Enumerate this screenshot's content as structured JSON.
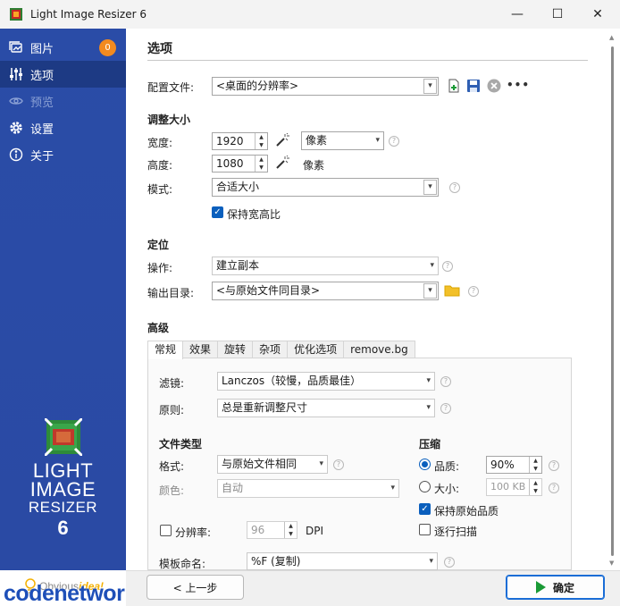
{
  "window": {
    "title": "Light Image Resizer 6",
    "controls": {
      "minimize": "—",
      "maximize": "☐",
      "close": "✕"
    }
  },
  "sidebar": {
    "items": [
      {
        "label": "图片",
        "icon": "images-icon",
        "badge": "0"
      },
      {
        "label": "选项",
        "icon": "sliders-icon",
        "active": true
      },
      {
        "label": "预览",
        "icon": "eye-icon",
        "disabled": true
      },
      {
        "label": "设置",
        "icon": "gear-icon"
      },
      {
        "label": "关于",
        "icon": "info-icon"
      }
    ],
    "logo": {
      "line1": "LIGHT",
      "line2": "IMAGE",
      "line3": "RESIZER",
      "version": "6"
    },
    "vendor": {
      "prefix": "Obvious",
      "emph": "idea!"
    },
    "watermark": "codenetwork.cn"
  },
  "page": {
    "title": "选项"
  },
  "profile": {
    "label": "配置文件:",
    "value": "<桌面的分辨率>",
    "more": "•••"
  },
  "resize": {
    "heading": "调整大小",
    "width_label": "宽度:",
    "width_value": "1920",
    "width_unit": "像素",
    "height_label": "高度:",
    "height_value": "1080",
    "height_unit": "像素",
    "mode_label": "模式:",
    "mode_value": "合适大小",
    "keep_ratio_label": "保持宽高比",
    "keep_ratio_checked": true
  },
  "target": {
    "heading": "定位",
    "action_label": "操作:",
    "action_value": "建立副本",
    "output_label": "输出目录:",
    "output_value": "<与原始文件同目录>"
  },
  "advanced": {
    "heading": "高级",
    "tabs": [
      "常规",
      "效果",
      "旋转",
      "杂项",
      "优化选项",
      "remove.bg"
    ],
    "filter_label": "滤镜:",
    "filter_value": "Lanczos（较慢，品质最佳）",
    "rule_label": "原则:",
    "rule_value": "总是重新调整尺寸",
    "filetype_heading": "文件类型",
    "format_label": "格式:",
    "format_value": "与原始文件相同",
    "color_label": "颜色:",
    "color_value": "自动",
    "resolution_label": "分辨率:",
    "resolution_value": "96",
    "resolution_unit": "DPI",
    "resolution_checked": false,
    "template_label": "模板命名:",
    "template_value": "%F (复制)",
    "compression_heading": "压缩",
    "quality_label": "品质:",
    "quality_value": "90%",
    "size_label": "大小:",
    "size_value": "100 KB",
    "keep_quality_label": "保持原始品质",
    "keep_quality_checked": true,
    "progressive_label": "逐行扫描",
    "progressive_checked": false
  },
  "footer": {
    "back_label": "< 上一步",
    "ok_label": "确定"
  },
  "colors": {
    "sidebar": "#2a4ca7",
    "sidebar_active": "#1d3a84",
    "badge": "#f28a1f",
    "accent": "#0a5fbd",
    "ok_play": "#1a9a36",
    "folder": "#f2c029",
    "watermark": "#1e4fb8"
  }
}
